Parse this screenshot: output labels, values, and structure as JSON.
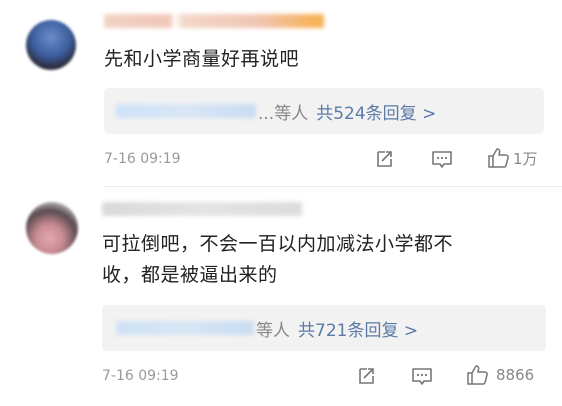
{
  "comments": [
    {
      "text_lines": [
        "先和小学商量好再说吧"
      ],
      "reply_suffix": "...等人",
      "reply_count": "共524条回复 >",
      "time": "7-16 09:19",
      "likes": "1万",
      "icons": [
        "share-icon",
        "comment-icon",
        "like-icon"
      ]
    },
    {
      "text_lines": [
        "可拉倒吧，不会一百以内加减法小学都不",
        "收，都是被逼出来的"
      ],
      "reply_suffix": "等人",
      "reply_count": "共721条回复 >",
      "time": "7-16 09:19",
      "likes": "8866",
      "icons": [
        "share-icon",
        "comment-icon",
        "like-icon"
      ]
    }
  ]
}
